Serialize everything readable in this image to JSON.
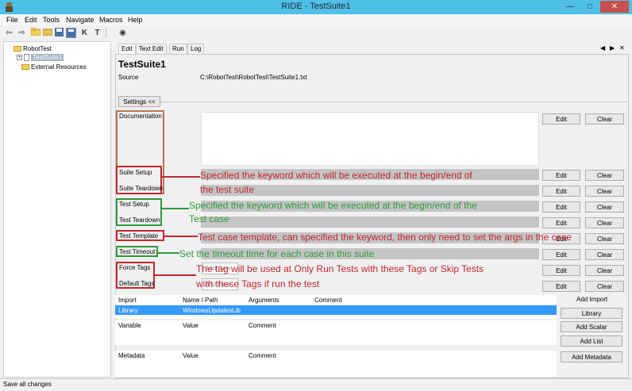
{
  "window": {
    "title": "RIDE - TestSuite1",
    "controls": [
      "—",
      "□",
      "✕"
    ]
  },
  "menu": [
    "File",
    "Edit",
    "Tools",
    "Navigate",
    "Macros",
    "Help"
  ],
  "toolbar_icons": [
    "back-icon",
    "forward-icon",
    "open-folder-icon",
    "open-file-icon",
    "save-icon",
    "save-all-icon",
    "keyword-search-icon",
    "text-icon",
    "stop-icon"
  ],
  "toolbar_glyphs": [
    "⇦",
    "⇨",
    "📂",
    "📁",
    "💾",
    "▦",
    "K",
    "T",
    "◉"
  ],
  "tree": {
    "root": "RobotTest",
    "child": "TestSuite1",
    "resources": "External Resources",
    "expand_glyph": "+"
  },
  "tabs": [
    "Edit",
    "Text Edit",
    "Run",
    "Log"
  ],
  "tab_nav": [
    "◀",
    "▶",
    "✕"
  ],
  "suite": {
    "name": "TestSuite1",
    "source_label": "Source",
    "source_path": "C:\\RobotTest\\RobotTest\\TestSuite1.txt"
  },
  "settings_button": "Settings <<",
  "settings": {
    "documentation": "Documentation",
    "suite_setup": "Suite Setup",
    "suite_teardown": "Suite Teardown",
    "test_setup": "Test Setup",
    "test_teardown": "Test Teardown",
    "test_template": "Test Template",
    "test_timeout": "Test Timeout",
    "force_tags": "Force Tags",
    "default_tags": "Default Tags"
  },
  "tag_inputs": [
    "Add New",
    "Add New"
  ],
  "buttons": {
    "edit": "Edit",
    "clear": "Clear",
    "add_import": "Add Import",
    "library": "Library",
    "add_scalar": "Add Scalar",
    "add_list": "Add List",
    "add_metadata": "Add Metadata"
  },
  "import_table": {
    "columns": [
      "Import",
      "Name / Path",
      "Arguments",
      "Comment"
    ],
    "rows": [
      [
        "Library",
        "WindowsUpdatesLib",
        "",
        ""
      ]
    ]
  },
  "variable_table": {
    "columns": [
      "Variable",
      "Value",
      "Comment"
    ]
  },
  "metadata_table": {
    "columns": [
      "Metadata",
      "Value",
      "Comment"
    ]
  },
  "annotations": {
    "suite_line1": "Specified the keyword which will be executed at the begin/end of",
    "suite_line2": "the test suite",
    "test_line1": "Specified the keyword which will be executed at the begin/end of the",
    "test_line2": "Test case",
    "template": "Test case template, can specified the keyword, then only need to set the args in the case",
    "timeout": "Set the timeout time for each case in this suite",
    "tags_line1": "The tag will be used at Only Run Tests with these Tags or Skip Tests",
    "tags_line2": "with these Tags if run the test"
  },
  "colors": {
    "titlebar": "#4fbfe6",
    "annotation_red": "#c0272d",
    "annotation_green": "#2f9a3a",
    "selection_blue": "#3399ff"
  },
  "status": "Save all changes"
}
